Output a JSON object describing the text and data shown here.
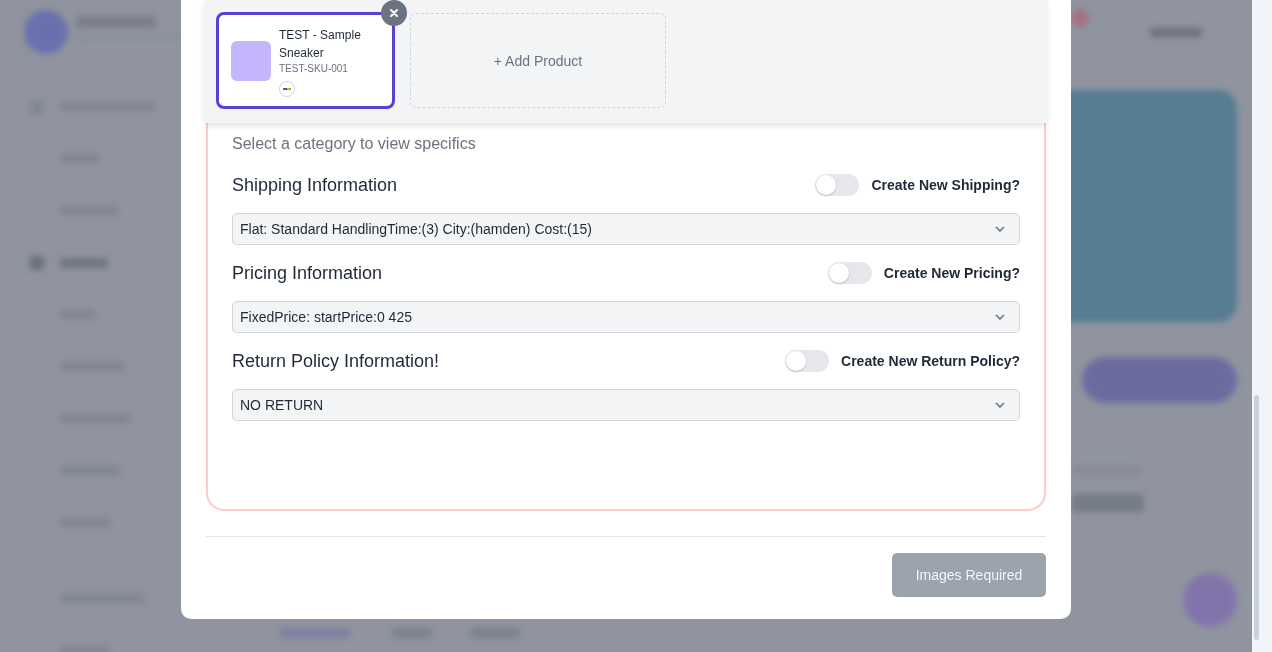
{
  "product_bar": {
    "products": [
      {
        "name": "TEST - Sample Sneaker",
        "sku": "TEST-SKU-001",
        "selected": true
      }
    ],
    "add_label": "+ Add Product"
  },
  "form": {
    "subtitle": "Select a category to view specifics",
    "sections": [
      {
        "title": "Shipping Information",
        "toggle_label": "Create New Shipping?",
        "on": false,
        "value": "Flat: Standard HandlingTime:(3) City:(hamden) Cost:(15)"
      },
      {
        "title": "Pricing Information",
        "toggle_label": "Create New Pricing?",
        "on": false,
        "value": "FixedPrice: startPrice:0 425"
      },
      {
        "title": "Return Policy Information!",
        "toggle_label": "Create New Return Policy?",
        "on": false,
        "value": "NO RETURN"
      }
    ]
  },
  "footer": {
    "button": {
      "label": "Images Required",
      "disabled": true
    }
  }
}
